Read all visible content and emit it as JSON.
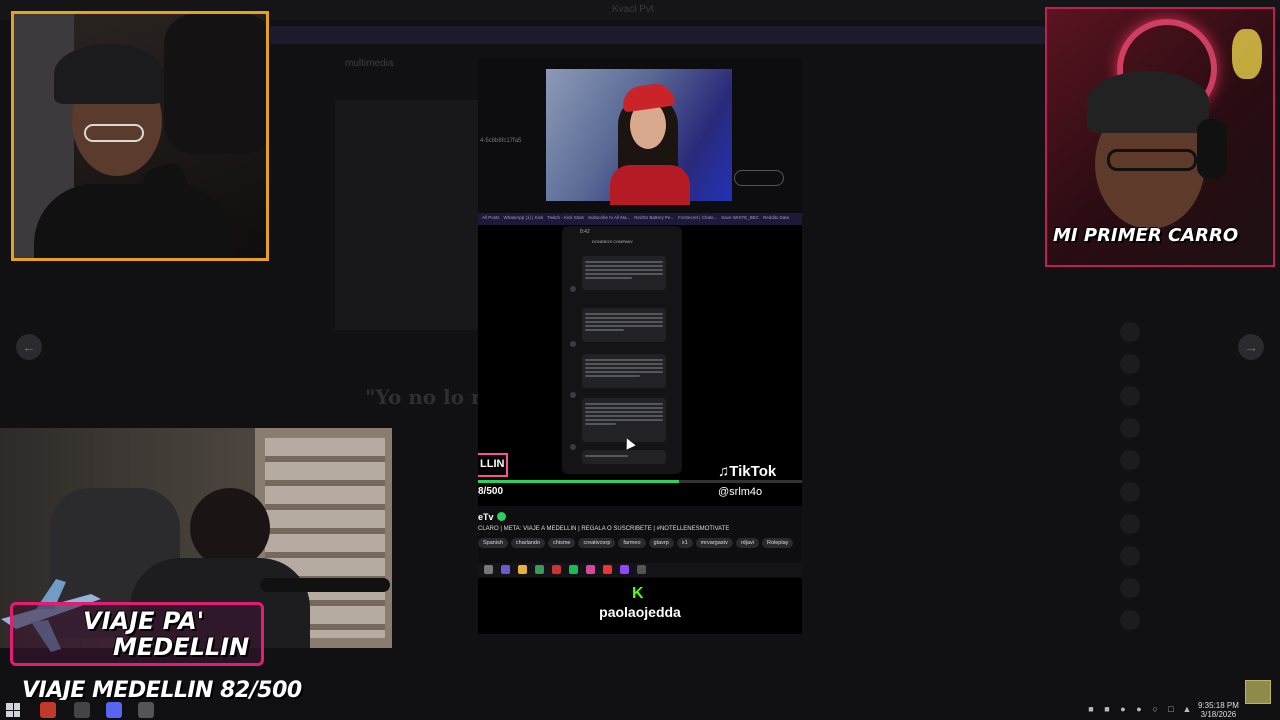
{
  "background": {
    "window_title": "Kvacl Pvt",
    "banner_text": "",
    "channel_path": "multimedia",
    "quote": "\"Yo no lo re... (Parte",
    "sidebar_rows": [
      "",
      "",
      "",
      "",
      ""
    ]
  },
  "webcams": {
    "top_right_overlay": "MI PRIMER CARRO"
  },
  "goal_widget": {
    "title_line1": "VIAJE PA'",
    "title_line2": "MEDELLIN",
    "label": "VIAJE MEDELLIN 82/500",
    "progress_fraction": 0.164
  },
  "clip": {
    "url_snippet": "4-5c8b8fc17fa5",
    "browser_tabs": [
      "All Posts",
      "WhatsApp (1) | Kick",
      "Twitch - Kick Stats",
      "Subscribe to All Ma...",
      "RedStr Battery Pe...",
      "ForSecret | Chats...",
      "Save WHITE_BEC",
      "Redditx Data"
    ],
    "phone_time": "8:42",
    "phone_header": "DONEBOS COMPANY",
    "tiktok_logo": "TikTok",
    "tiktok_handle": "@srlm4o",
    "counter_text": "8/500",
    "badge_text": "LLIN",
    "stream_name": "eTv",
    "stream_title": "CLARO | META: VIAJE A MEDELLIN | REGALA O SUSCRIBETE | #NOTELLENESMOTIVATE",
    "tags": [
      "Spanish",
      "charlando",
      "chisme",
      "creativosrp",
      "farmeo",
      "gtavrp",
      "x1",
      "mrvargastv",
      "rdjavi",
      "Roleplay"
    ],
    "progress_fraction": 0.62,
    "kick_user": "paolaojedda"
  },
  "taskbar": {
    "time": "9:35:18 PM",
    "date": "3/18/2026"
  },
  "colors": {
    "cam_tl_border": "#e6a21a",
    "cam_tr_border": "#bf1f52",
    "goal_border": "#e11d74",
    "kick_green": "#53fc18"
  }
}
